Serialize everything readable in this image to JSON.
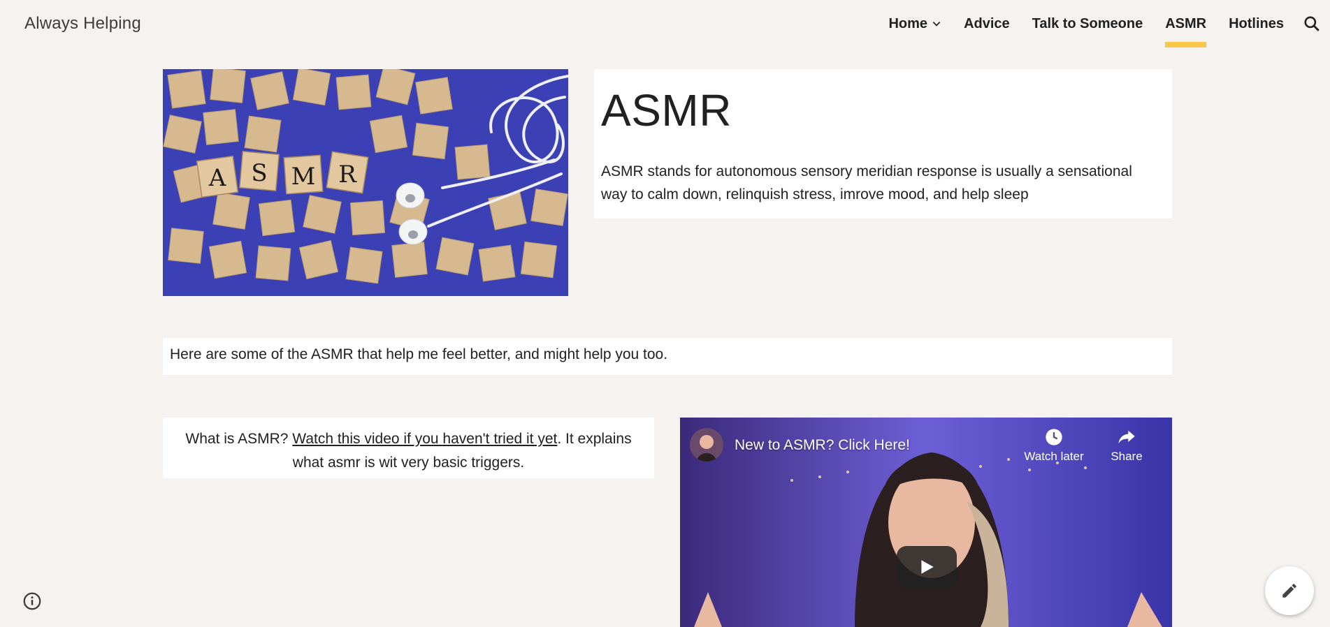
{
  "site": {
    "title": "Always Helping"
  },
  "nav": {
    "items": [
      {
        "label": "Home",
        "has_dropdown": true,
        "active": false
      },
      {
        "label": "Advice",
        "active": false
      },
      {
        "label": "Talk to Someone",
        "active": false
      },
      {
        "label": "ASMR",
        "active": true
      },
      {
        "label": "Hotlines",
        "active": false
      }
    ],
    "search_icon": "search-icon",
    "accent_color": "#f9c947"
  },
  "hero": {
    "image_tiles_letters": [
      "A",
      "S",
      "M",
      "R"
    ],
    "heading": "ASMR",
    "description": "ASMR stands for autonomous sensory meridian response is usually a sensational way to calm down, relinquish stress, imrove mood, and help sleep"
  },
  "intro": {
    "text": "Here are some of the ASMR that help me feel better, and might help you too."
  },
  "what_is": {
    "prefix": "What is ASMR? ",
    "link_text": "Watch this video if you haven't tried it yet",
    "suffix": ". It explains what asmr is wit very basic triggers."
  },
  "video": {
    "title": "New to ASMR? Click Here!",
    "watch_later_label": "Watch later",
    "share_label": "Share"
  },
  "colors": {
    "page_bg": "#f5f2ef",
    "card_bg": "#ffffff",
    "text": "#212121"
  }
}
